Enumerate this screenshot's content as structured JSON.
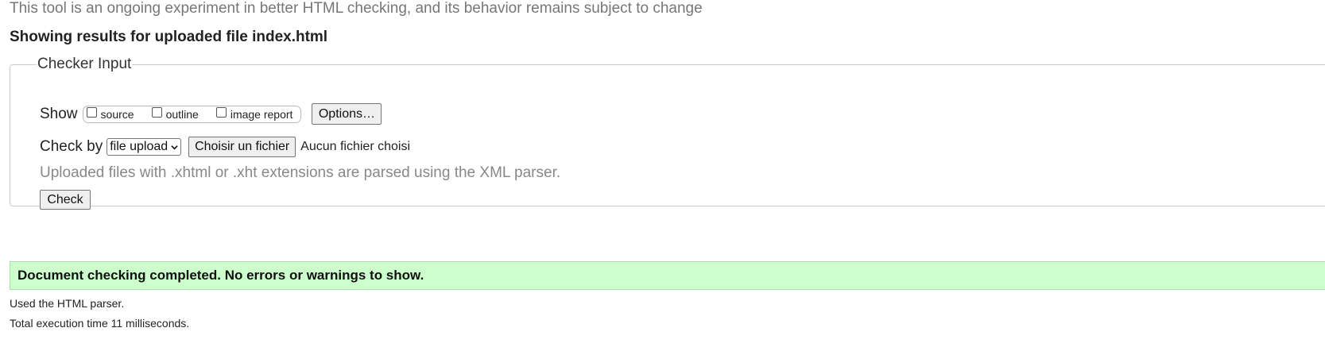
{
  "intro_text": "This tool is an ongoing experiment in better HTML checking, and its behavior remains subject to change",
  "results_heading": "Showing results for uploaded file index.html",
  "checker": {
    "legend": "Checker Input",
    "show_label": "Show",
    "show_options": [
      {
        "label": "source",
        "checked": false
      },
      {
        "label": "outline",
        "checked": false
      },
      {
        "label": "image report",
        "checked": false
      }
    ],
    "options_button": "Options…",
    "check_by_label": "Check by",
    "check_by_selected": "file upload",
    "choose_file_button": "Choisir un fichier",
    "no_file_text": "Aucun fichier choisi",
    "upload_note": "Uploaded files with .xhtml or .xht extensions are parsed using the XML parser.",
    "check_button": "Check"
  },
  "result": {
    "message": "Document checking completed. No errors or warnings to show.",
    "parser_note": "Used the HTML parser.",
    "execution_time": "Total execution time 11 milliseconds."
  },
  "colors": {
    "success_bg": "#ccffcc",
    "muted_text": "#777777"
  }
}
